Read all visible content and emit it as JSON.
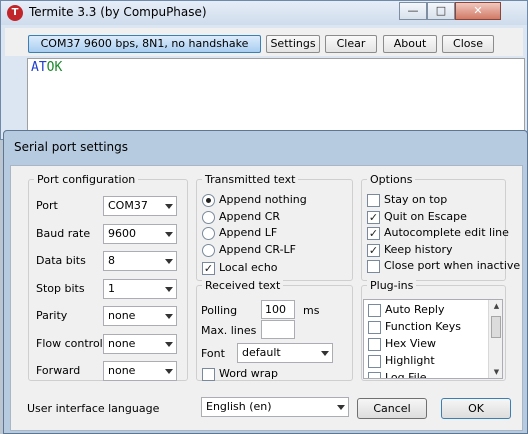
{
  "window": {
    "title": "Termite 3.3 (by CompuPhase)",
    "app_icon_glyph": "T",
    "min_glyph": "—",
    "max_glyph": "□",
    "close_glyph": "✕"
  },
  "toolbar": {
    "status": "COM37 9600 bps, 8N1, no handshake",
    "settings": "Settings",
    "clear": "Clear",
    "about": "About",
    "close": "Close"
  },
  "terminal": {
    "sent": "AT",
    "received": "OK"
  },
  "colors": {
    "sent_text": "#1f3fd0",
    "received_text": "#1a8a2a"
  },
  "dialog": {
    "title": "Serial port settings",
    "port_config": {
      "title": "Port configuration",
      "fields": [
        {
          "label": "Port",
          "value": "COM37"
        },
        {
          "label": "Baud rate",
          "value": "9600"
        },
        {
          "label": "Data bits",
          "value": "8"
        },
        {
          "label": "Stop bits",
          "value": "1"
        },
        {
          "label": "Parity",
          "value": "none"
        },
        {
          "label": "Flow control",
          "value": "none"
        },
        {
          "label": "Forward",
          "value": "none"
        }
      ]
    },
    "transmitted": {
      "title": "Transmitted text",
      "radios": [
        {
          "label": "Append nothing",
          "checked": true
        },
        {
          "label": "Append CR",
          "checked": false
        },
        {
          "label": "Append LF",
          "checked": false
        },
        {
          "label": "Append CR-LF",
          "checked": false
        }
      ],
      "local_echo": {
        "label": "Local echo",
        "checked": true
      }
    },
    "received": {
      "title": "Received text",
      "polling_label": "Polling",
      "polling_value": "100",
      "polling_unit": "ms",
      "max_lines_label": "Max. lines",
      "max_lines_value": "",
      "font_label": "Font",
      "font_value": "default",
      "word_wrap": {
        "label": "Word wrap",
        "checked": false
      }
    },
    "options": {
      "title": "Options",
      "items": [
        {
          "label": "Stay on top",
          "checked": false
        },
        {
          "label": "Quit on Escape",
          "checked": true
        },
        {
          "label": "Autocomplete edit line",
          "checked": true
        },
        {
          "label": "Keep history",
          "checked": true
        },
        {
          "label": "Close port when inactive",
          "checked": false
        }
      ]
    },
    "plugins": {
      "title": "Plug-ins",
      "items": [
        {
          "label": "Auto Reply",
          "checked": false
        },
        {
          "label": "Function Keys",
          "checked": false
        },
        {
          "label": "Hex View",
          "checked": false
        },
        {
          "label": "Highlight",
          "checked": false
        },
        {
          "label": "Log File",
          "checked": false
        }
      ]
    },
    "ui_language_label": "User interface language",
    "ui_language_value": "English (en)",
    "cancel": "Cancel",
    "ok": "OK",
    "check_glyph": "✓",
    "scroll_up_glyph": "▲",
    "scroll_down_glyph": "▼"
  }
}
